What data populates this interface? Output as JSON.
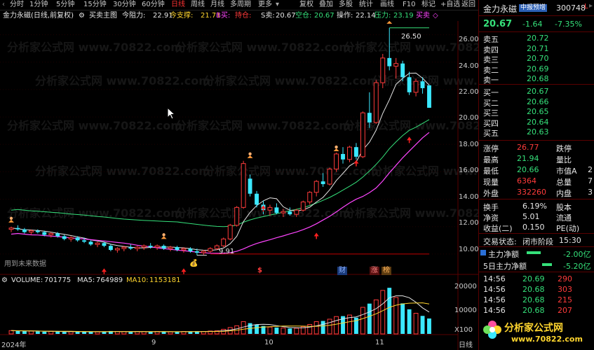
{
  "toolbar": {
    "tabs": [
      "分时",
      "1分钟",
      "5分钟",
      "15分钟",
      "30分钟",
      "60分钟",
      "日线",
      "周线",
      "月线",
      "多周期",
      "更多"
    ],
    "active_tab": "日线",
    "tools": [
      "复权",
      "叠加",
      "多股",
      "统计",
      "画线",
      "F10",
      "标记"
    ],
    "right_tools": [
      "+自选",
      "返回"
    ]
  },
  "indicator_bar": {
    "title": "金力永磁(日线,前复权)",
    "indicator_name": "买卖主图",
    "items": [
      {
        "label": "今阻力:",
        "value": "22.91",
        "color": "#e6e6e6"
      },
      {
        "label": "今支撑:",
        "value": "21.71",
        "color": "#ffd52e"
      },
      {
        "label": "B买:",
        "value": "",
        "color": "#ff45ff"
      },
      {
        "label": "持仓:",
        "value": "",
        "color": "#ff3b3b"
      },
      {
        "label": "S卖:",
        "value": "20.67",
        "color": "#e6e6e6"
      },
      {
        "label": "空仓:",
        "value": "20.67",
        "color": "#35e07a"
      },
      {
        "label": "操作:",
        "value": "22.14",
        "color": "#e6e6e6"
      },
      {
        "label": "压力:",
        "value": "23.19",
        "color": "#35e07a"
      },
      {
        "label": "买卖",
        "value": "",
        "color": "#ff45ff"
      }
    ]
  },
  "price_axis": [
    "26.00",
    "24.00",
    "22.00",
    "20.00",
    "18.00",
    "16.00",
    "14.00",
    "12.00",
    "10.00"
  ],
  "annotations": {
    "high_label": "26.50",
    "low_label": "9.91",
    "future_data": "用到未来数据",
    "badges": [
      "$",
      "财",
      "涨",
      "榜"
    ]
  },
  "volume": {
    "label": "VOLUME:",
    "value": "701775",
    "ma5_label": "MA5:",
    "ma5": "764989",
    "ma10_label": "MA10:",
    "ma10": "1153181",
    "axis": [
      "20000",
      "10000"
    ],
    "unit": "X100"
  },
  "date_axis": [
    "2024年",
    "9",
    "10",
    "11",
    "日线"
  ],
  "watermark": "分析家公式网 www.70822.com",
  "right": {
    "name": "金力永磁",
    "tag": "中报预增",
    "code": "300748",
    "flag": "L",
    "price": "20.67",
    "change": "-1.64",
    "change_pct": "-7.35%",
    "asks": [
      {
        "label": "卖五",
        "price": "20.72"
      },
      {
        "label": "卖四",
        "price": "20.71"
      },
      {
        "label": "卖三",
        "price": "20.70"
      },
      {
        "label": "卖二",
        "price": "20.69"
      },
      {
        "label": "卖一",
        "price": "20.68"
      }
    ],
    "bids": [
      {
        "label": "买一",
        "price": "20.67"
      },
      {
        "label": "买二",
        "price": "20.66"
      },
      {
        "label": "买三",
        "price": "20.65"
      },
      {
        "label": "买四",
        "price": "20.64"
      },
      {
        "label": "买五",
        "price": "20.63"
      }
    ],
    "stats": [
      {
        "l1": "涨停",
        "v1": "26.77",
        "c1": "red",
        "l2": "跌停",
        "v2": ""
      },
      {
        "l1": "最高",
        "v1": "21.94",
        "c1": "green",
        "l2": "量比",
        "v2": ""
      },
      {
        "l1": "最低",
        "v1": "20.66",
        "c1": "green",
        "l2": "市值A",
        "v2": "2"
      },
      {
        "l1": "现量",
        "v1": "6364",
        "c1": "red",
        "l2": "总量",
        "v2": "7"
      },
      {
        "l1": "外盘",
        "v1": "332260",
        "c1": "red",
        "l2": "内盘",
        "v2": "3"
      }
    ],
    "stats2": [
      {
        "l1": "换手",
        "v1": "6.19%",
        "l2": "股本",
        "v2": ""
      },
      {
        "l1": "净资",
        "v1": "5.01",
        "l2": "流通",
        "v2": ""
      },
      {
        "l1": "收益(二)",
        "v1": "0.150",
        "l2": "PE(动)",
        "v2": ""
      }
    ],
    "trade_status_label": "交易状态:",
    "trade_status": "闭市阶段",
    "trade_time": "15:30",
    "flow": [
      {
        "label": "主力净额",
        "value": "-2.00亿"
      },
      {
        "label": "5日主力净额",
        "value": "-5.20亿"
      }
    ],
    "ticks": [
      {
        "time": "14:56",
        "price": "20.69",
        "vol": "290"
      },
      {
        "time": "14:56",
        "price": "20.68",
        "vol": "303"
      },
      {
        "time": "14:56",
        "price": "20.68",
        "vol": "215"
      },
      {
        "time": "14:56",
        "price": "20.68",
        "vol": "207"
      }
    ],
    "logo_text": "分析家公式网",
    "logo_url": "www.70822.com"
  },
  "chart_data": {
    "type": "candlestick",
    "ylim": [
      9.0,
      27.0
    ],
    "x_labels": [
      "2024年",
      "9",
      "10",
      "11"
    ],
    "ohlc": [
      [
        11.8,
        12.0,
        11.6,
        11.9
      ],
      [
        11.9,
        12.1,
        11.7,
        11.8
      ],
      [
        11.8,
        11.9,
        11.5,
        11.6
      ],
      [
        11.6,
        11.8,
        11.4,
        11.7
      ],
      [
        11.7,
        11.8,
        11.5,
        11.6
      ],
      [
        11.6,
        11.7,
        11.3,
        11.4
      ],
      [
        11.4,
        11.6,
        11.2,
        11.5
      ],
      [
        11.5,
        11.6,
        11.2,
        11.3
      ],
      [
        11.3,
        11.4,
        11.0,
        11.1
      ],
      [
        11.1,
        11.3,
        10.9,
        11.2
      ],
      [
        11.2,
        11.3,
        10.9,
        11.0
      ],
      [
        11.0,
        11.2,
        10.8,
        10.9
      ],
      [
        10.9,
        11.0,
        10.6,
        10.7
      ],
      [
        10.7,
        10.9,
        10.5,
        10.8
      ],
      [
        10.8,
        10.9,
        10.5,
        10.6
      ],
      [
        10.6,
        10.7,
        10.2,
        10.3
      ],
      [
        10.3,
        10.5,
        10.1,
        10.4
      ],
      [
        10.4,
        10.6,
        10.2,
        10.5
      ],
      [
        10.5,
        10.7,
        10.3,
        10.4
      ],
      [
        10.4,
        10.6,
        10.2,
        10.5
      ],
      [
        10.5,
        10.7,
        10.3,
        10.6
      ],
      [
        10.6,
        10.8,
        10.4,
        10.5
      ],
      [
        10.5,
        10.7,
        10.3,
        10.6
      ],
      [
        10.6,
        10.7,
        10.3,
        10.4
      ],
      [
        10.4,
        10.6,
        10.2,
        10.5
      ],
      [
        10.5,
        10.6,
        10.2,
        10.3
      ],
      [
        10.3,
        10.5,
        10.1,
        10.4
      ],
      [
        10.4,
        10.5,
        10.1,
        10.2
      ],
      [
        10.2,
        10.4,
        9.91,
        10.1
      ],
      [
        10.1,
        10.3,
        9.95,
        10.2
      ],
      [
        10.2,
        10.5,
        10.1,
        10.4
      ],
      [
        10.4,
        10.7,
        10.3,
        10.6
      ],
      [
        10.6,
        11.2,
        10.5,
        11.1
      ],
      [
        11.1,
        12.2,
        11.0,
        12.1
      ],
      [
        12.1,
        13.5,
        12.0,
        13.4
      ],
      [
        13.4,
        16.8,
        13.3,
        16.6
      ],
      [
        15.5,
        15.8,
        14.2,
        14.4
      ],
      [
        14.4,
        14.6,
        13.4,
        13.6
      ],
      [
        13.6,
        13.9,
        12.9,
        13.2
      ],
      [
        13.2,
        13.6,
        12.8,
        13.4
      ],
      [
        13.4,
        13.7,
        12.9,
        13.0
      ],
      [
        13.0,
        13.3,
        12.7,
        13.1
      ],
      [
        13.1,
        13.4,
        12.8,
        12.9
      ],
      [
        12.9,
        13.3,
        12.7,
        13.2
      ],
      [
        13.2,
        13.9,
        13.1,
        13.8
      ],
      [
        13.8,
        14.6,
        13.6,
        14.5
      ],
      [
        14.5,
        15.4,
        14.2,
        15.3
      ],
      [
        15.3,
        15.9,
        14.9,
        15.1
      ],
      [
        15.1,
        16.3,
        15.0,
        16.2
      ],
      [
        16.2,
        17.4,
        16.0,
        17.3
      ],
      [
        17.3,
        17.8,
        16.6,
        16.9
      ],
      [
        16.9,
        17.9,
        16.7,
        17.8
      ],
      [
        17.8,
        18.1,
        16.9,
        17.1
      ],
      [
        17.1,
        20.4,
        17.0,
        20.3
      ],
      [
        20.3,
        21.8,
        19.2,
        19.6
      ],
      [
        19.6,
        22.7,
        19.5,
        22.5
      ],
      [
        22.5,
        24.6,
        22.1,
        24.3
      ],
      [
        24.3,
        26.5,
        23.4,
        23.7
      ],
      [
        23.7,
        24.3,
        22.8,
        23.9
      ],
      [
        23.9,
        24.1,
        22.6,
        22.9
      ],
      [
        22.9,
        23.3,
        21.6,
        21.8
      ],
      [
        21.8,
        22.8,
        21.5,
        22.6
      ],
      [
        22.6,
        22.9,
        21.7,
        22.1
      ],
      [
        22.31,
        21.94,
        20.66,
        20.67
      ]
    ],
    "volume": [
      1500,
      1400,
      1200,
      1300,
      1100,
      1000,
      1200,
      1100,
      900,
      1000,
      950,
      1000,
      1100,
      900,
      1000,
      1300,
      1100,
      1000,
      900,
      1050,
      1000,
      950,
      1100,
      1000,
      900,
      1000,
      1100,
      1050,
      1200,
      1100,
      1300,
      1400,
      2100,
      2900,
      3700,
      5600,
      4900,
      4200,
      3600,
      3100,
      2900,
      2700,
      2500,
      2600,
      3300,
      4300,
      5600,
      5900,
      6700,
      7900,
      8100,
      8600,
      7400,
      12100,
      13800,
      15500,
      19800,
      21000,
      16600,
      13900,
      11200,
      9400,
      8200,
      7018
    ]
  }
}
